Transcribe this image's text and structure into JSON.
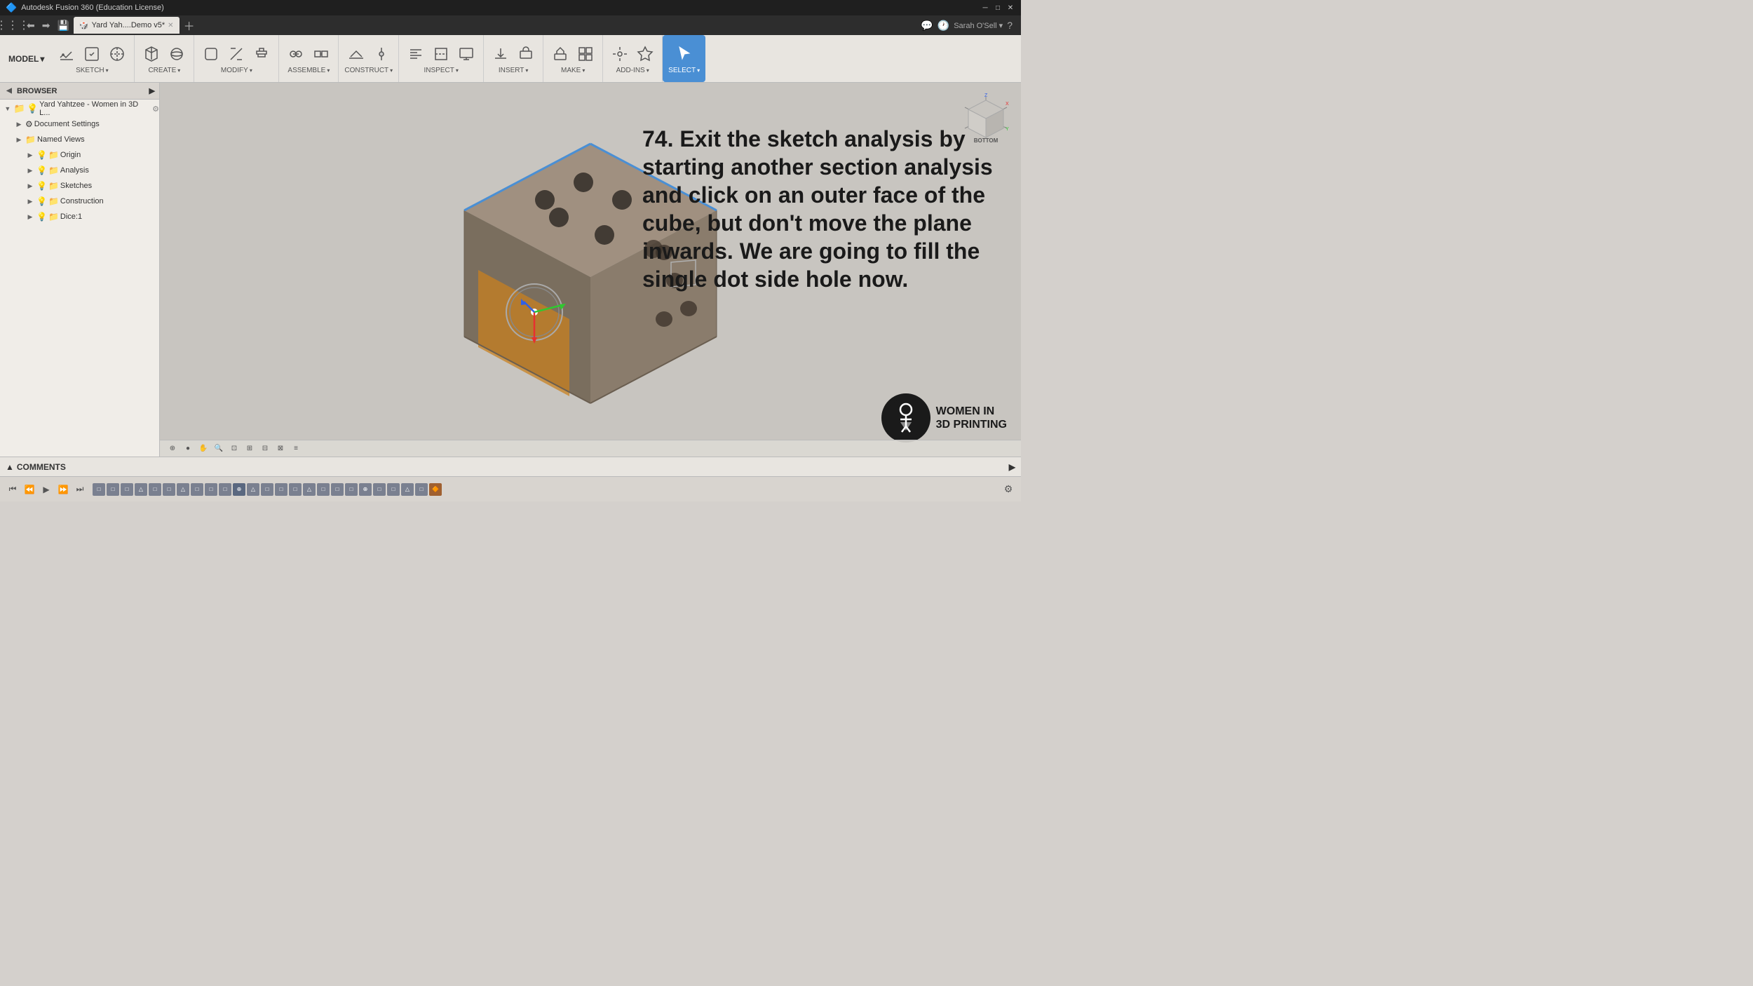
{
  "titleBar": {
    "appName": "Autodesk Fusion 360 (Education License)",
    "controls": [
      "─",
      "□",
      "✕"
    ]
  },
  "tabBar": {
    "activeTab": "Yard Yah....Demo v5*",
    "tabIcon": "🎲"
  },
  "toolbar": {
    "modelLabel": "MODEL",
    "groups": [
      {
        "name": "sketch",
        "label": "SKETCH",
        "hasDropdown": true,
        "icons": [
          "sketch",
          "finish-sketch",
          "project"
        ]
      },
      {
        "name": "create",
        "label": "CREATE",
        "hasDropdown": true,
        "icons": [
          "box",
          "sphere",
          "cylinder"
        ]
      },
      {
        "name": "modify",
        "label": "MODIFY",
        "hasDropdown": true,
        "icons": [
          "fillet",
          "chamfer",
          "shell"
        ]
      },
      {
        "name": "assemble",
        "label": "ASSEMBLE",
        "hasDropdown": true,
        "icons": [
          "joint",
          "ground",
          "contact"
        ]
      },
      {
        "name": "construct",
        "label": "CONSTRUCT",
        "hasDropdown": true,
        "icons": [
          "plane",
          "axis",
          "point"
        ]
      },
      {
        "name": "inspect",
        "label": "INSPECT",
        "hasDropdown": true,
        "icons": [
          "measure",
          "section",
          "display"
        ]
      },
      {
        "name": "insert",
        "label": "INSERT",
        "hasDropdown": true,
        "icons": [
          "insert"
        ]
      },
      {
        "name": "make",
        "label": "MAKE",
        "hasDropdown": true,
        "icons": [
          "3dprint"
        ]
      },
      {
        "name": "addins",
        "label": "ADD-INS",
        "hasDropdown": true,
        "icons": [
          "addins"
        ]
      },
      {
        "name": "select",
        "label": "SELECT",
        "hasDropdown": true,
        "icons": [
          "select"
        ],
        "isActive": true
      }
    ]
  },
  "browser": {
    "title": "BROWSER",
    "rootItem": "Yard Yahtzee - Women in 3D L...",
    "items": [
      {
        "label": "Document Settings",
        "depth": 1,
        "expanded": false,
        "icon": "gear"
      },
      {
        "label": "Named Views",
        "depth": 1,
        "expanded": false,
        "icon": "folder"
      },
      {
        "label": "Origin",
        "depth": 2,
        "expanded": false,
        "icon": "folder",
        "hasLight": true
      },
      {
        "label": "Analysis",
        "depth": 2,
        "expanded": false,
        "icon": "folder",
        "hasLight": true
      },
      {
        "label": "Sketches",
        "depth": 2,
        "expanded": false,
        "icon": "folder",
        "hasLight": true
      },
      {
        "label": "Construction",
        "depth": 2,
        "expanded": false,
        "icon": "folder",
        "hasLight": true
      },
      {
        "label": "Dice:1",
        "depth": 2,
        "expanded": false,
        "icon": "folder",
        "hasLight": true
      }
    ]
  },
  "instruction": {
    "number": "74.",
    "text": "Exit the sketch analysis by starting another section analysis and click on an outer face of the cube, but don't move the plane inwards. We are going to fill the single dot side hole now."
  },
  "logo": {
    "org": "WOMEN IN",
    "line2": "3D PRINTING",
    "symbol": "▽"
  },
  "comments": {
    "label": "COMMENTS"
  },
  "bottomBar": {
    "icons": [
      "⟲",
      "⟲",
      "▷",
      "⟳",
      "⊕",
      "⊖",
      "⊡",
      "⊞",
      "⊟"
    ]
  },
  "viewCube": {
    "label": "BOTTOM"
  }
}
